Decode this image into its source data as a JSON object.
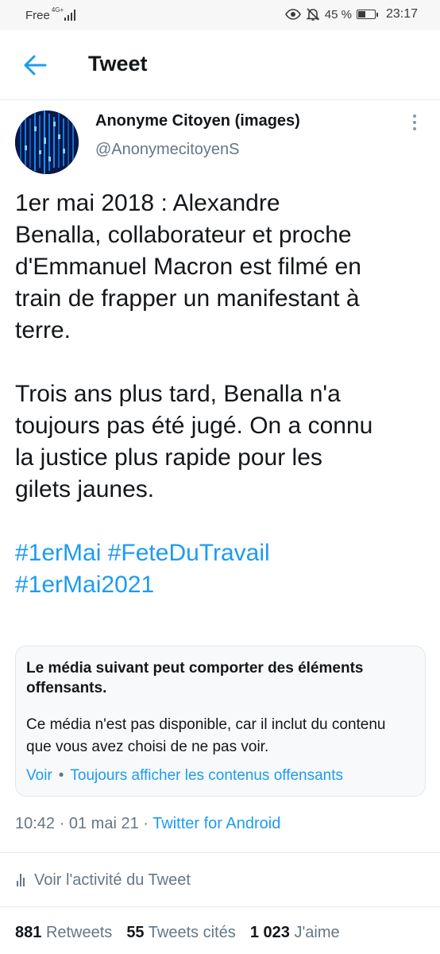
{
  "status_bar": {
    "carrier": "Free",
    "network": "4G+",
    "battery_percent": "45 %",
    "battery_level": 0.45,
    "time": "23:17",
    "icons": [
      "eye-icon",
      "bell-off-icon"
    ]
  },
  "header": {
    "title": "Tweet",
    "back_icon": "arrow-left-icon"
  },
  "author": {
    "display_name": "Anonyme Citoyen (images)",
    "handle": "@AnonymecitoyenS"
  },
  "tweet": {
    "paragraph1": [
      "1er mai 2018 : Alexandre",
      "Benalla, collaborateur et proche",
      "d'Emmanuel Macron est filmé en",
      "train de frapper un manifestant à",
      "terre."
    ],
    "paragraph2": [
      "Trois ans plus tard, Benalla n'a",
      "toujours pas été jugé. On a connu",
      "la justice plus rapide pour les",
      "gilets jaunes."
    ],
    "hashtags": [
      "#1erMai",
      "#FeteDuTravail",
      "#1erMai2021"
    ]
  },
  "media_warning": {
    "title": "Le média suivant peut comporter des éléments offensants.",
    "description": "Ce média n'est pas disponible, car il inclut du contenu que vous avez choisi de ne pas voir.",
    "view_label": "Voir",
    "separator": "•",
    "always_show_label": "Toujours afficher les contenus offensants"
  },
  "meta": {
    "time": "10:42",
    "date": "01 mai 21",
    "separator": "·",
    "source": "Twitter for Android"
  },
  "activity": {
    "label": "Voir l'activité du Tweet"
  },
  "stats": {
    "retweets_count": "881",
    "retweets_label": "Retweets",
    "quotes_count": "55",
    "quotes_label": "Tweets cités",
    "likes_count": "1 023",
    "likes_label": "J'aime"
  },
  "colors": {
    "accent": "#1d9bf0",
    "secondary_text": "#657786",
    "avatar_bg": "#07184a"
  }
}
